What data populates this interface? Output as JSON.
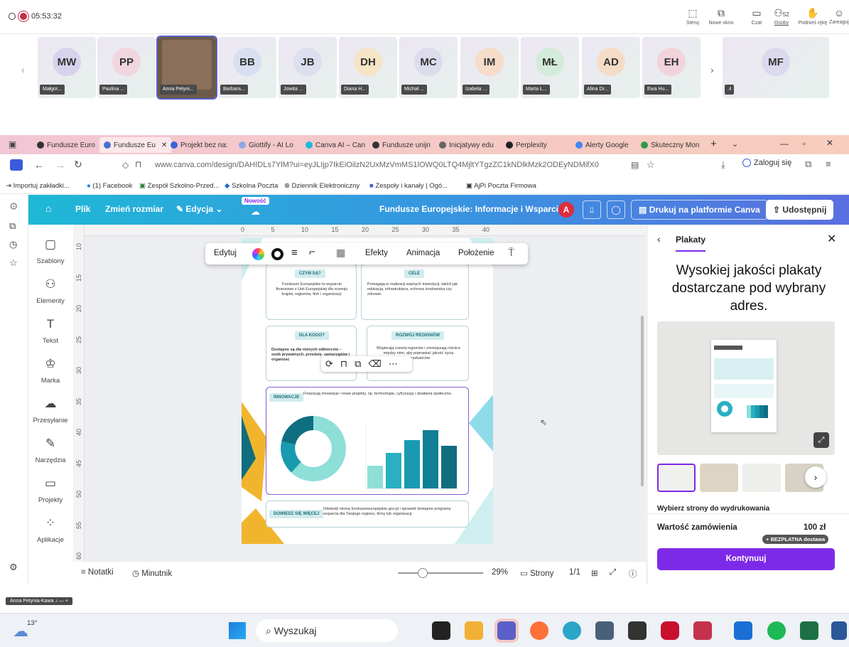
{
  "teams": {
    "timer": "05:53:32",
    "actions": [
      {
        "label": "Steruj",
        "icon": "control-icon"
      },
      {
        "label": "Nowe okno",
        "icon": "new-window-icon"
      },
      {
        "label": "Czat",
        "icon": "chat-icon"
      },
      {
        "label": "Osoby",
        "icon": "people-icon",
        "badge": "52"
      },
      {
        "label": "Podnieś rękę",
        "icon": "raise-hand-icon"
      },
      {
        "label": "Zareaguj",
        "icon": "react-icon"
      }
    ],
    "participants": [
      {
        "initials": "MW",
        "name": "Małgor...",
        "color": "#d9d2ec"
      },
      {
        "initials": "PP",
        "name": "Paulina ...",
        "color": "#f1d6df"
      },
      {
        "initials": "",
        "name": "Anna Petyni...",
        "color": "#6b5a4a"
      },
      {
        "initials": "BB",
        "name": "Barbara...",
        "color": "#d8dff0"
      },
      {
        "initials": "JB",
        "name": "Jowita ...",
        "color": "#dcdfef"
      },
      {
        "initials": "DH",
        "name": "Diana H...",
        "color": "#f5e4c6"
      },
      {
        "initials": "MC",
        "name": "Michał ...",
        "color": "#dcdcec"
      },
      {
        "initials": "IM",
        "name": "Izabela ...",
        "color": "#f6dcc9"
      },
      {
        "initials": "MŁ",
        "name": "Marta Ł...",
        "color": "#d3ecd9"
      },
      {
        "initials": "AD",
        "name": "Alina Dr...",
        "color": "#f4dcc8"
      },
      {
        "initials": "EH",
        "name": "Ewa Hu...",
        "color": "#f2d3dc"
      },
      {
        "initials": "MF",
        "name": "",
        "color": "#dcd8ee"
      }
    ],
    "self_label": "Anna Petynia-Kawa"
  },
  "browser": {
    "tabs": [
      "Fundusze Euro",
      "Fundusze Eu",
      "Projekt bez na:",
      "Giottify - AI Lo",
      "Canva AI – Can",
      "Fundusze unijn",
      "Inicjatywy edu",
      "Perplexity",
      "Alerty Google",
      "Skuteczny Mon"
    ],
    "url": "www.canva.com/design/DAHIDLs7YlM?ui=eyJLIjp7IkEiOilzN2UxMzVmMS1lOWQ0LTQ4MjltYTgzZC1kNDlkMzk2ODEyNDMifX0",
    "login": "Zaloguj się",
    "bookmarks": [
      "Importuj zakładki...",
      "(1) Facebook",
      "Zespół Szkolno-Przed...",
      "Szkolna Poczta",
      "Dziennik Elektroniczny",
      "Zespoły i kanały | Ogó...",
      "AjPi Poczta Firmowa"
    ]
  },
  "canva": {
    "menu": {
      "file": "Plik",
      "resize": "Zmień rozmiar",
      "edit": "Edycja",
      "new_badge": "Nowość"
    },
    "doc_title": "Fundusze Europejskie: Informacje i Wsparcie",
    "avatar": "A",
    "print": "Drukuj na platformie Canva",
    "share": "Udostępnij",
    "sidebar": [
      "Szablony",
      "Elementy",
      "Tekst",
      "Marka",
      "Przesyłanie",
      "Narzędzia",
      "Projekty",
      "Aplikacje"
    ],
    "ruler_h": [
      "0",
      "5",
      "10",
      "15",
      "20",
      "25",
      "30",
      "35",
      "40"
    ],
    "ruler_v": [
      "10",
      "15",
      "20",
      "25",
      "30",
      "35",
      "40",
      "45",
      "50",
      "55",
      "60"
    ],
    "toolbar": {
      "edit": "Edytuj",
      "effects": "Efekty",
      "animation": "Animacja",
      "position": "Położenie"
    },
    "poster": {
      "card1_title": "CZYM SĄ?",
      "card1_text": "Fundusze Europejskie to wsparcie finansowe z Unii Europejskiej dla rozwoju krajów, regionów, firm i organizacji.",
      "card2_title": "CELE",
      "card2_text": "Pomagają w realizacji ważnych inwestycji, takich jak edukacja, infrastruktura, ochrona środowiska czy zdrowie.",
      "card3_title": "DLA KOGO?",
      "card3_text": "Dostępne są dla różnych odbiorców – osób prywatnych, przedsię- samorządów i organizac",
      "card4_title": "ROZWÓJ REGIONÓW",
      "card4_text": "Wspierają rozwój regionów i zmniejszają różnice między nimi, aby poprawiać jakość życia mieszkańców.",
      "innov_title": "INNOWACJE",
      "innov_text": "Finansują innowacje i nowe projekty, np. technologie, cyfryzację i działania społeczne.",
      "more_title": "DOWIEDZ SIĘ WIĘCEJ",
      "more_text": "Odwiedź stronę funduszeeuropejskie.gov.pl i sprawdź dostępne programy wsparcia dla Twojego regionu, firmy lub organizacji."
    },
    "bottom": {
      "notes": "Notatki",
      "timer": "Minutnik",
      "zoom": "29%",
      "pages": "Strony",
      "page_count": "1/1"
    },
    "panel": {
      "back_label": "Plakaty",
      "headline": "Wysokiej jakości plakaty dostarczane pod wybrany adres.",
      "pick_pages": "Wybierz strony do wydrukowania",
      "order_label": "Wartość zamówienia",
      "order_value": "100 zł",
      "free_shipping": "+ BEZPŁATNA dostawa",
      "continue": "Kontynuuj"
    }
  },
  "taskbar": {
    "weather": "13°",
    "search": "Wyszukaj"
  },
  "colors": {
    "accent": "#7d2ae8",
    "canva_teal": "#1fb8d6",
    "poster_teal": "#1b6e78"
  }
}
